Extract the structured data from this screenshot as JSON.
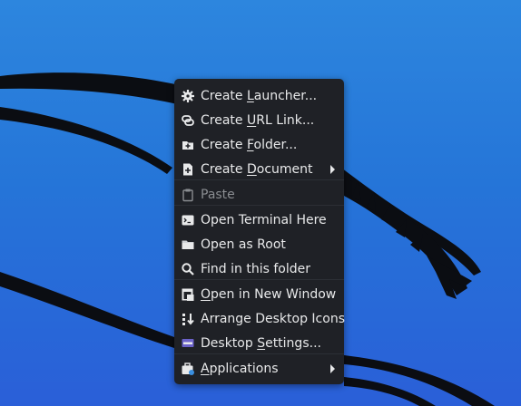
{
  "desktop": {
    "background_color": "#2779da"
  },
  "context_menu": {
    "items": [
      {
        "pre": "Create ",
        "mn": "L",
        "post": "auncher...",
        "icon": "gear-icon",
        "disabled": false
      },
      {
        "pre": "Create ",
        "mn": "U",
        "post": "RL Link...",
        "icon": "link-icon",
        "disabled": false
      },
      {
        "pre": "Create ",
        "mn": "F",
        "post": "older...",
        "icon": "new-folder-icon",
        "disabled": false
      },
      {
        "pre": "Create ",
        "mn": "D",
        "post": "ocument",
        "icon": "new-document-icon",
        "disabled": false,
        "submenu": true
      },
      {
        "pre": "",
        "mn": "",
        "post": "Paste",
        "icon": "clipboard-icon",
        "disabled": true
      },
      {
        "pre": "",
        "mn": "",
        "post": "Open Terminal Here",
        "icon": "terminal-icon",
        "disabled": false
      },
      {
        "pre": "",
        "mn": "",
        "post": "Open as Root",
        "icon": "folder-icon",
        "disabled": false
      },
      {
        "pre": "",
        "mn": "",
        "post": "Find in this folder",
        "icon": "search-icon",
        "disabled": false
      },
      {
        "pre": "",
        "mn": "O",
        "post": "pen in New Window",
        "icon": "new-window-icon",
        "disabled": false
      },
      {
        "pre": "",
        "mn": "",
        "post": "Arrange Desktop Icons",
        "icon": "arrange-icons-icon",
        "disabled": false
      },
      {
        "pre": "Desktop ",
        "mn": "S",
        "post": "ettings...",
        "icon": "desktop-settings-icon",
        "disabled": false
      },
      {
        "pre": "",
        "mn": "A",
        "post": "pplications",
        "icon": "applications-icon",
        "disabled": false,
        "submenu": true
      }
    ]
  },
  "colors": {
    "menu_bg": "#1f2126",
    "menu_text": "#e8e9ea",
    "disabled_text": "#8a8d91"
  }
}
